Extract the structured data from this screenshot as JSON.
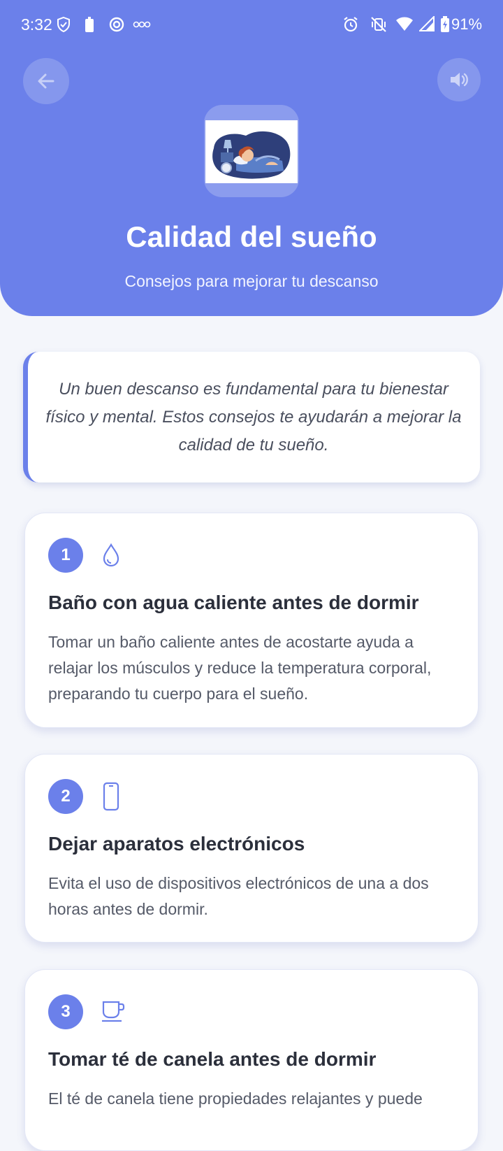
{
  "status_bar": {
    "time": "3:32",
    "battery": "91%"
  },
  "header": {
    "title": "Calidad del sueño",
    "subtitle": "Consejos para mejorar tu descanso",
    "accent_color": "#6b80ea"
  },
  "intro": {
    "text": "Un buen descanso es fundamental para tu bienestar físico y mental. Estos consejos te ayudarán a mejorar la calidad de tu sueño."
  },
  "tips": [
    {
      "number": "1",
      "icon": "water-drop-icon",
      "title": "Baño con agua caliente antes de dormir",
      "body": "Tomar un baño caliente antes de acostarte ayuda a relajar los músculos y reduce la temperatura corporal, preparando tu cuerpo para el sueño."
    },
    {
      "number": "2",
      "icon": "smartphone-icon",
      "title": "Dejar aparatos electrónicos",
      "body": "Evita el uso de dispositivos electrónicos de una a dos horas antes de dormir."
    },
    {
      "number": "3",
      "icon": "tea-cup-icon",
      "title": "Tomar té de canela antes de dormir",
      "body": "El té de canela tiene propiedades relajantes y puede"
    }
  ]
}
